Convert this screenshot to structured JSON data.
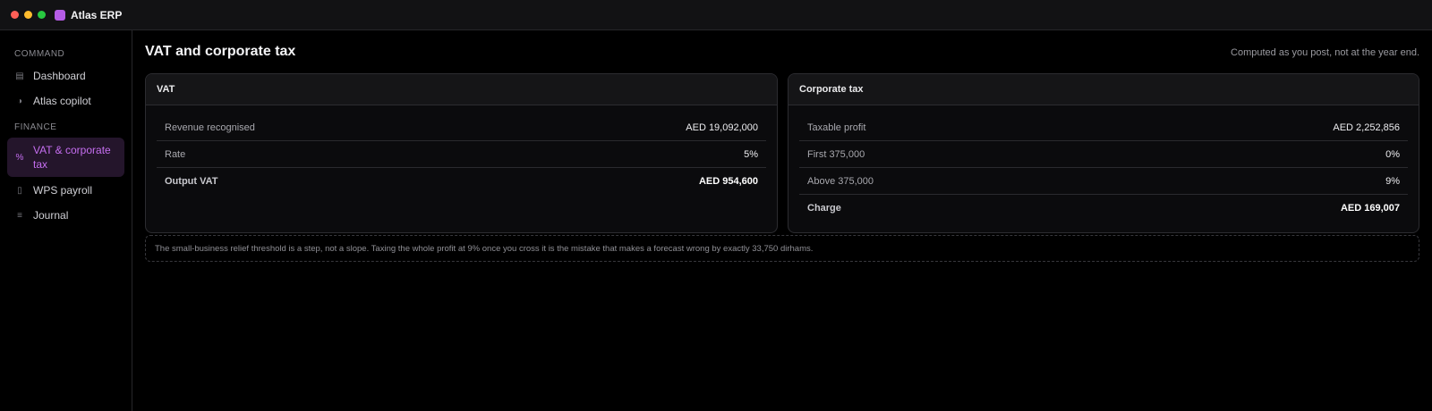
{
  "window": {
    "app_title": "Atlas ERP",
    "accent_color": "#c56ef0"
  },
  "sidebar": {
    "sections": [
      {
        "label": "COMMAND",
        "items": [
          {
            "label": "Dashboard",
            "icon": "grid-icon"
          },
          {
            "label": "Atlas copilot",
            "icon": "half-circle-icon"
          }
        ]
      },
      {
        "label": "FINANCE",
        "items": [
          {
            "label": "VAT & corporate tax",
            "icon": "percent-icon",
            "active": true
          },
          {
            "label": "WPS payroll",
            "icon": "calculator-icon"
          },
          {
            "label": "Journal",
            "icon": "list-icon"
          }
        ]
      }
    ]
  },
  "main": {
    "title": "VAT and corporate tax",
    "subtitle": "Computed as you post, not at the year end.",
    "vat": {
      "heading": "VAT",
      "rows": [
        {
          "label": "Revenue recognised",
          "value": "AED 19,092,000"
        },
        {
          "label": "Rate",
          "value": "5%"
        },
        {
          "label": "Output VAT",
          "value": "AED 954,600"
        }
      ]
    },
    "corporate": {
      "heading": "Corporate tax",
      "rows": [
        {
          "label": "Taxable profit",
          "value": "AED 2,252,856"
        },
        {
          "label": "First 375,000",
          "value": "0%"
        },
        {
          "label": "Above 375,000",
          "value": "9%"
        },
        {
          "label": "Charge",
          "value": "AED 169,007"
        }
      ]
    },
    "note": "The small-business relief threshold is a step, not a slope. Taxing the whole profit at 9% once you cross it is the mistake that makes a forecast wrong by exactly 33,750 dirhams."
  }
}
